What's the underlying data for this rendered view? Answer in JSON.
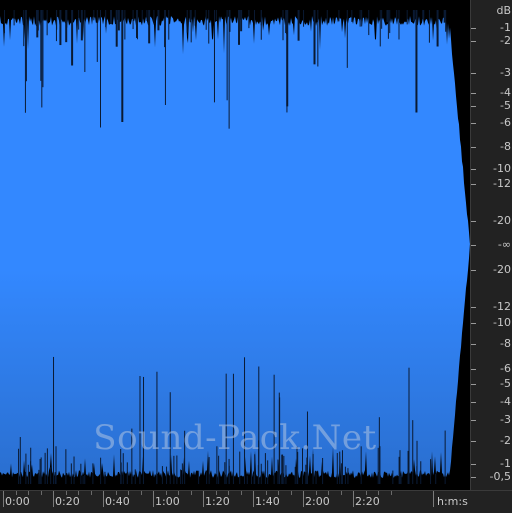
{
  "colors": {
    "waveform": "#3388ff",
    "waveform_bottom": "#2a6fd0",
    "background": "#000000",
    "ruler_bg": "#222222",
    "ruler_text": "#c8c8c8"
  },
  "db_ruler": {
    "unit": "dB",
    "labels": [
      "-1",
      "-2",
      "-3",
      "-4",
      "-5",
      "-6",
      "-8",
      "-10",
      "-12",
      "-20",
      "-∞",
      "-20",
      "-12",
      "-10",
      "-8",
      "-6",
      "-5",
      "-4",
      "-3",
      "-2",
      "-1",
      "-0,5"
    ]
  },
  "time_ruler": {
    "labels": [
      "0:00",
      "0:20",
      "0:40",
      "1:00",
      "1:20",
      "1:40",
      "2:00",
      "2:20"
    ],
    "unit": "h:m:s"
  },
  "watermark": "Sound-Pack.Net",
  "icons": [
    "waveform-display"
  ]
}
